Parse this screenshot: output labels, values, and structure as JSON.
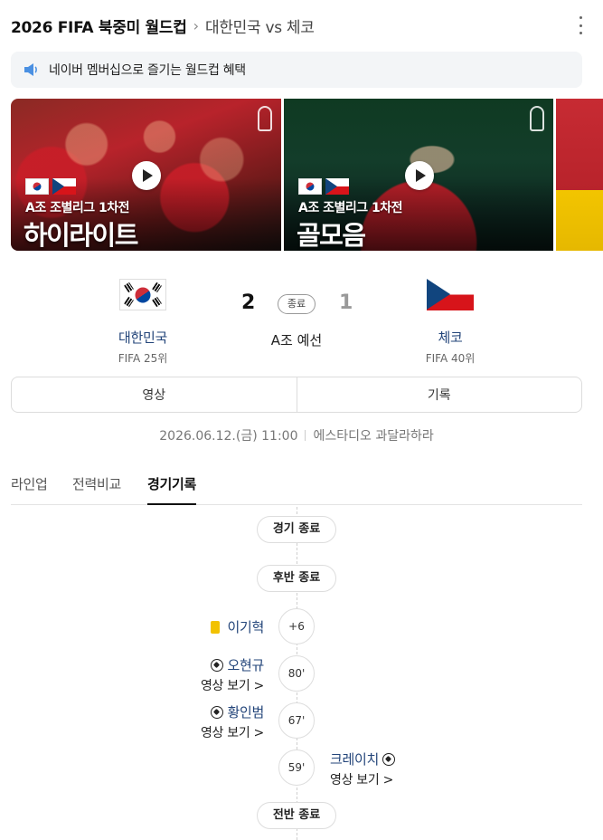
{
  "header": {
    "title": "2026 FIFA 북중미 월드컵",
    "match": "대한민국 vs 체코"
  },
  "notice": {
    "text": "네이버 멤버십으로 즐기는 월드컵 혜택"
  },
  "videos": [
    {
      "caption_small": "A조 조별리그 1차전",
      "caption_large": "하이라이트"
    },
    {
      "caption_small": "A조 조별리그 1차전",
      "caption_large": "골모음"
    }
  ],
  "scoreboard": {
    "home": {
      "name": "대한민국",
      "rank": "FIFA 25위",
      "score": "2"
    },
    "away": {
      "name": "체코",
      "rank": "FIFA 40위",
      "score": "1"
    },
    "status": "종료",
    "round": "A조 예선"
  },
  "buttons": {
    "video": "영상",
    "record": "기록"
  },
  "match_info": {
    "datetime": "2026.06.12.(금) 11:00",
    "venue": "에스타디오 과달라하라"
  },
  "tabs": {
    "lineup": "라인업",
    "compare": "전력비교",
    "record": "경기기록"
  },
  "timeline": {
    "game_end": "경기 종료",
    "second_half_end": "후반 종료",
    "first_half_end": "전반 종료",
    "events": [
      {
        "minute": "+6",
        "player": "이기혁",
        "type": "yellow-card",
        "side": "home"
      },
      {
        "minute": "80'",
        "player": "오현규",
        "type": "goal",
        "side": "home",
        "video": "영상 보기 >"
      },
      {
        "minute": "67'",
        "player": "황인범",
        "type": "goal",
        "side": "home",
        "video": "영상 보기 >"
      },
      {
        "minute": "59'",
        "player": "크레이치",
        "type": "goal",
        "side": "away",
        "video": "영상 보기 >"
      }
    ]
  },
  "colors": {
    "team_name": "#23457a",
    "yellow_card": "#f2c200",
    "korea_red": "#cd2e3a",
    "korea_blue": "#0047a0",
    "czech_red": "#d7141a",
    "czech_blue": "#11457e"
  },
  "icons": [
    "more-vertical-icon",
    "speaker-icon",
    "play-icon",
    "world-cup-trophy-icon",
    "korea-flag",
    "czech-flag",
    "yellow-card-icon",
    "soccer-ball-icon"
  ]
}
